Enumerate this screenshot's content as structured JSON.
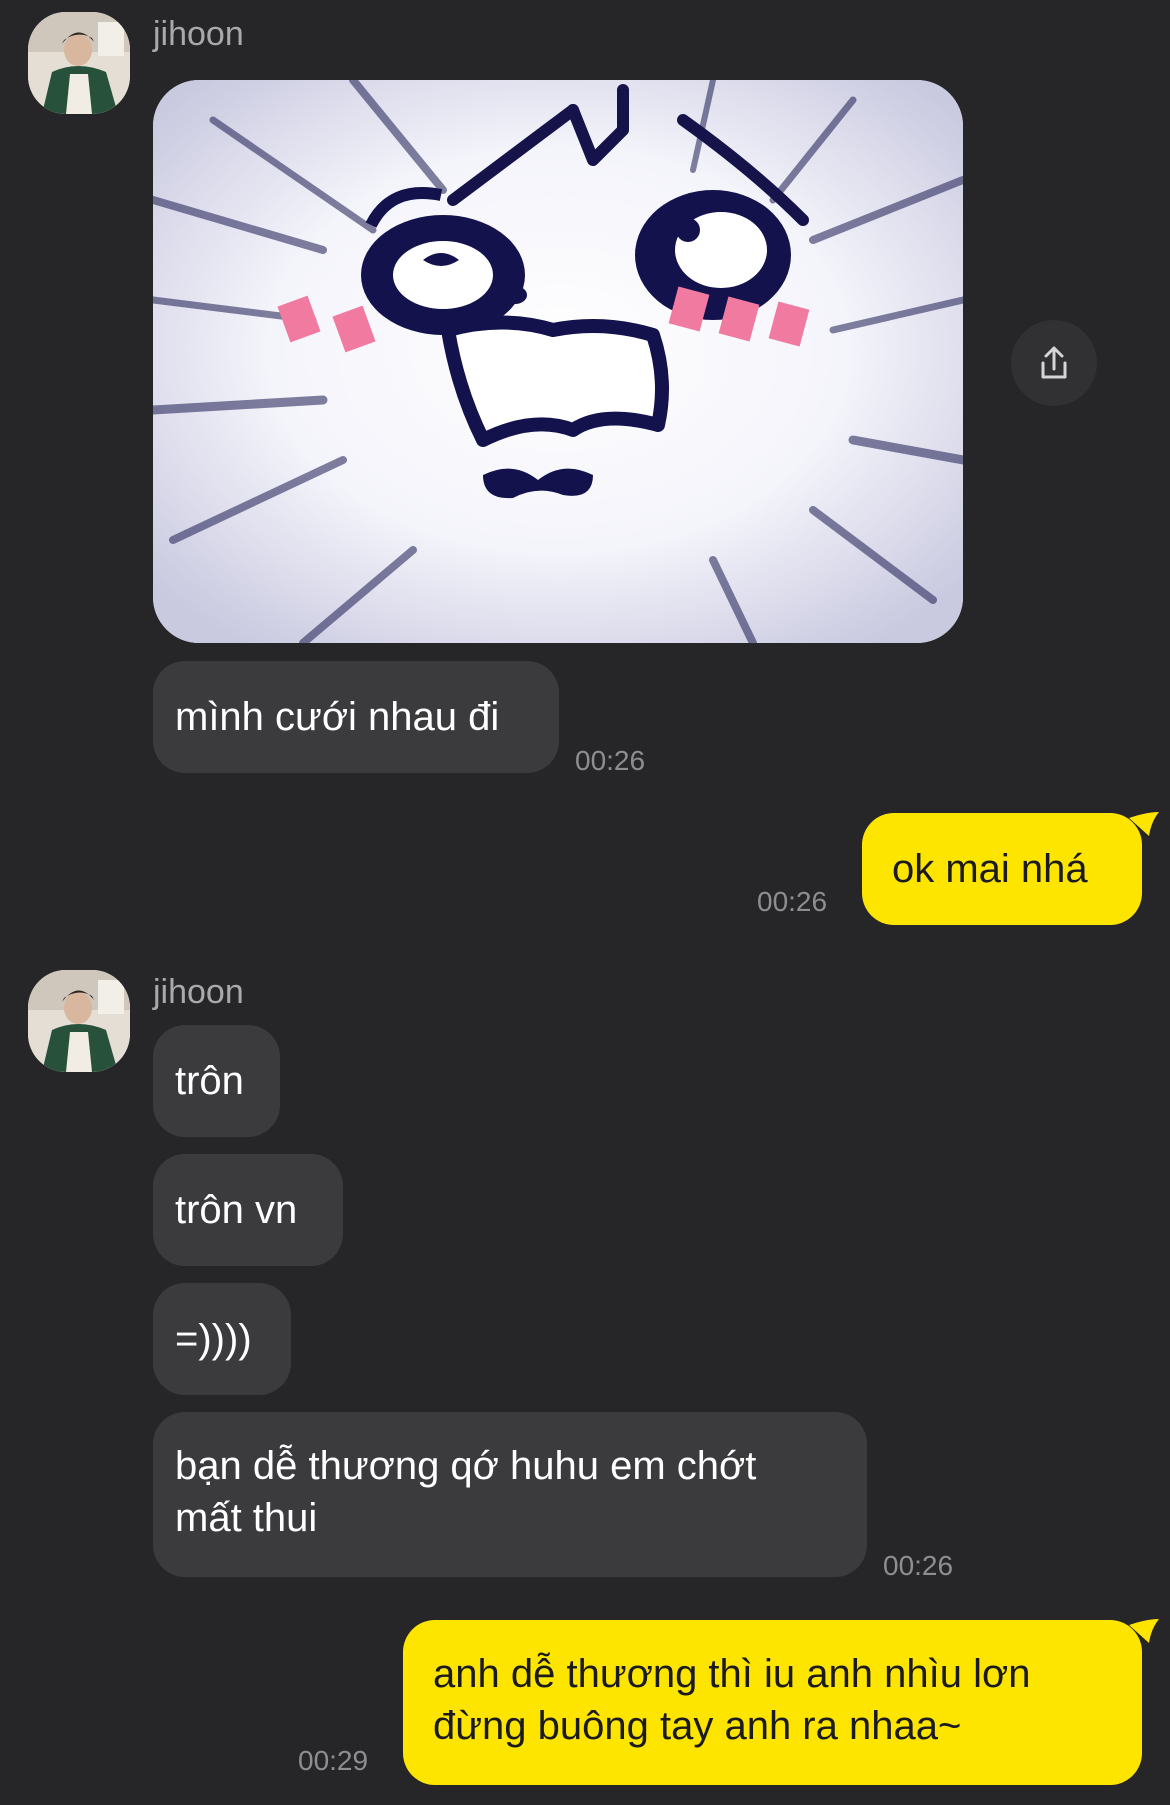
{
  "chat": {
    "contact_name": "jihoon",
    "messages": [
      {
        "text": "mình cưới nhau đi",
        "time": "00:26"
      },
      {
        "text": "ok mai nhá",
        "time": "00:26"
      },
      {
        "text": "trôn"
      },
      {
        "text": "trôn vn"
      },
      {
        "text": "=))))"
      },
      {
        "text_line1": "bạn dễ thương qớ huhu em chớt",
        "text_line2": "mất thui",
        "time": "00:26"
      },
      {
        "text_line1": "anh dễ thương thì iu anh nhìu lơn",
        "text_line2": "đừng buông tay anh ra nhaa~",
        "time": "00:29"
      }
    ]
  },
  "icons": {
    "share": "share-icon",
    "avatar": "avatar",
    "sticker": "crying-cat-sticker"
  },
  "colors": {
    "background": "#262628",
    "incoming_bubble": "#3b3b3e",
    "outgoing_bubble": "#fee500",
    "timestamp": "#8e8e92"
  }
}
